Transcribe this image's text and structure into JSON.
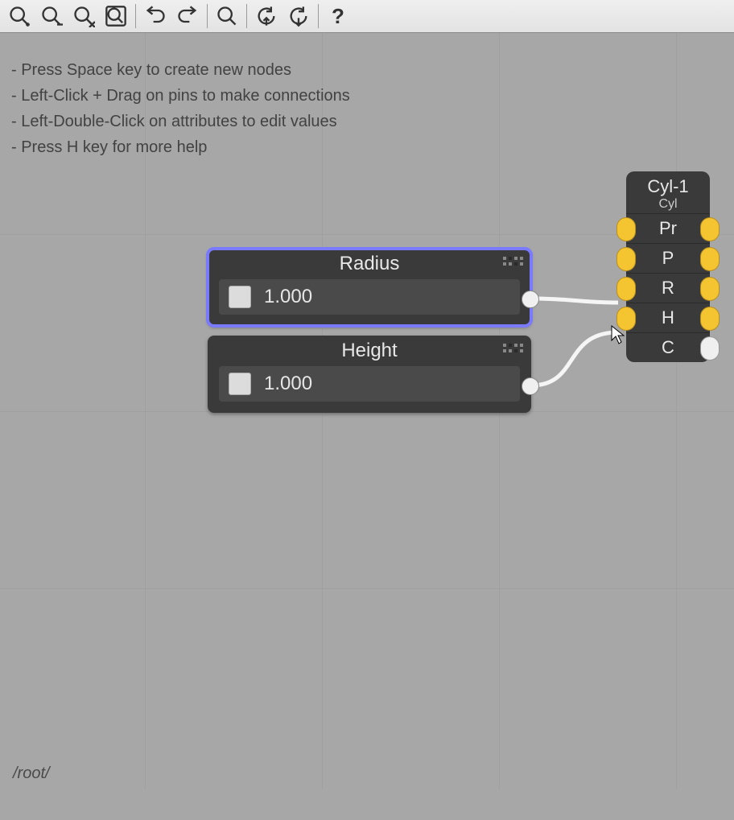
{
  "toolbar": {
    "zoom_in": "zoom-in",
    "zoom_out": "zoom-out",
    "zoom_reset": "zoom-reset",
    "zoom_fit": "zoom-fit",
    "undo": "undo",
    "redo": "redo",
    "find": "find",
    "refresh_up": "refresh-up",
    "refresh_down": "refresh-down",
    "help": "?"
  },
  "help_lines": [
    "- Press Space key to create new nodes",
    "- Left-Click + Drag on pins to make connections",
    "- Left-Double-Click on attributes to edit values",
    "- Press H key for more help"
  ],
  "nodes": {
    "radius": {
      "title": "Radius",
      "value": "1.000",
      "selected": true
    },
    "height": {
      "title": "Height",
      "value": "1.000",
      "selected": false
    }
  },
  "cyl": {
    "title": "Cyl-1",
    "subtitle": "Cyl",
    "rows": [
      {
        "label": "Pr",
        "left_pin": "y",
        "right_pin": "y"
      },
      {
        "label": "P",
        "left_pin": "y",
        "right_pin": "y"
      },
      {
        "label": "R",
        "left_pin": "y",
        "right_pin": "y"
      },
      {
        "label": "H",
        "left_pin": "y",
        "right_pin": "y"
      },
      {
        "label": "C",
        "left_pin": "",
        "right_pin": "w"
      }
    ]
  },
  "status_path": "/root/",
  "colors": {
    "selection": "#7a7aff",
    "pin_yellow": "#f5c431"
  }
}
